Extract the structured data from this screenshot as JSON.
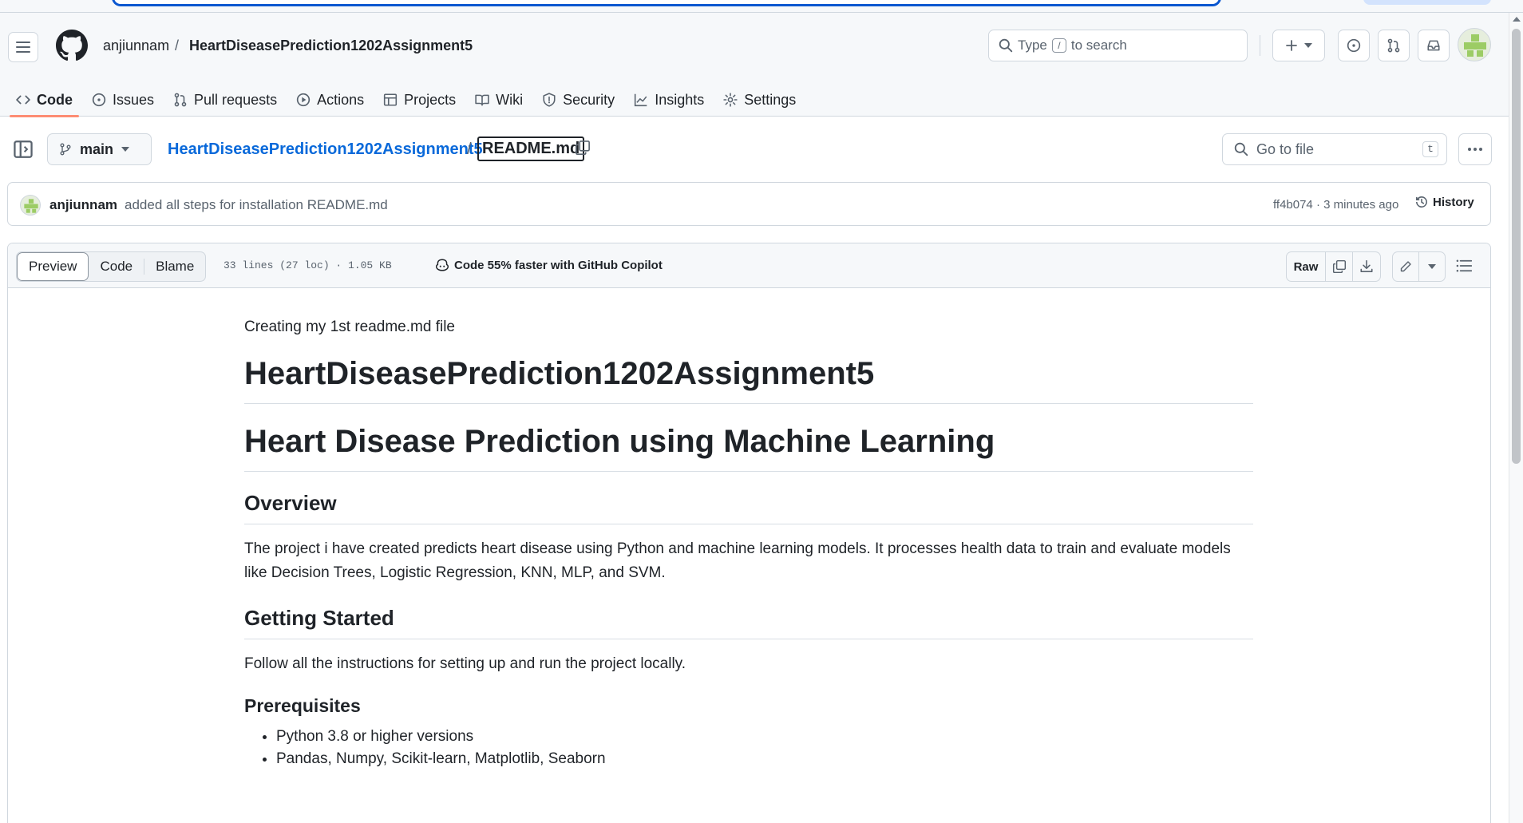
{
  "header": {
    "owner": "anjiunnam",
    "separator": "/",
    "repo": "HeartDiseasePrediction1202Assignment5",
    "search_prefix": "Type",
    "search_key": "/",
    "search_suffix": "to search"
  },
  "tabs": [
    {
      "label": "Code",
      "icon": "code-icon",
      "active": true
    },
    {
      "label": "Issues",
      "icon": "issue-icon"
    },
    {
      "label": "Pull requests",
      "icon": "pull-request-icon"
    },
    {
      "label": "Actions",
      "icon": "play-icon"
    },
    {
      "label": "Projects",
      "icon": "table-icon"
    },
    {
      "label": "Wiki",
      "icon": "book-icon"
    },
    {
      "label": "Security",
      "icon": "shield-icon"
    },
    {
      "label": "Insights",
      "icon": "graph-icon"
    },
    {
      "label": "Settings",
      "icon": "gear-icon"
    }
  ],
  "filebar": {
    "branch": "main",
    "path_repo": "HeartDiseasePrediction1202Assignment5",
    "path_sep": "/",
    "path_file": "README.md",
    "goto_placeholder": "Go to file",
    "goto_key": "t"
  },
  "commit": {
    "author": "anjiunnam",
    "message": "added all steps for installation README.md",
    "meta": "ff4b074 · 3 minutes ago",
    "history_label": "History"
  },
  "file_header": {
    "views": [
      "Preview",
      "Code",
      "Blame"
    ],
    "info": "33 lines (27 loc) · 1.05 KB",
    "copilot": "Code 55% faster with GitHub Copilot",
    "raw_label": "Raw"
  },
  "readme": {
    "intro": "Creating my 1st readme.md file",
    "h1_title": "HeartDiseasePrediction1202Assignment5",
    "h1_project": "Heart Disease Prediction using Machine Learning",
    "h2_overview": "Overview",
    "overview_text": "The project i have created predicts heart disease using Python and machine learning models. It processes health data to train and evaluate models like Decision Trees, Logistic Regression, KNN, MLP, and SVM.",
    "h2_getting_started": "Getting Started",
    "getting_started_text": "Follow all the instructions for setting up and run the project locally.",
    "h3_prereq": "Prerequisites",
    "prereq_items": [
      "Python 3.8 or higher versions",
      "Pandas, Numpy, Scikit-learn, Matplotlib, Seaborn"
    ]
  },
  "colors": {
    "link": "#0969da",
    "active_tab_underline": "#fd8c73",
    "border": "#d0d7de",
    "muted_text": "#59636e"
  }
}
